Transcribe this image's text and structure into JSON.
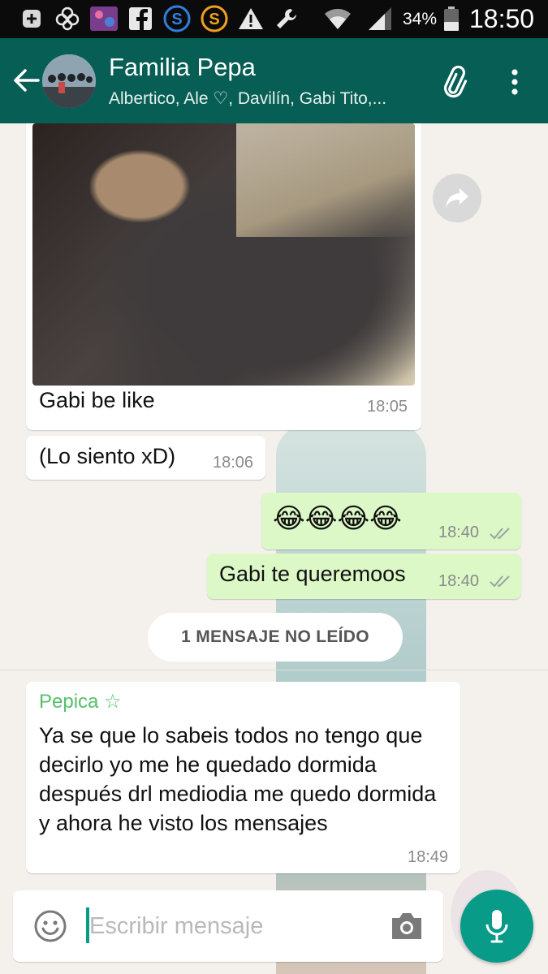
{
  "status_bar": {
    "battery_percent": "34%",
    "time": "18:50",
    "icons": [
      "plus-box-icon",
      "clover-icon",
      "gallery-icon",
      "facebook-icon",
      "s-blue-icon",
      "s-orange-icon",
      "warning-icon",
      "wrench-icon",
      "wifi-icon",
      "signal-icon",
      "battery-icon"
    ]
  },
  "header": {
    "title": "Familia Pepa",
    "subtitle": "Albertico, Ale ♡, Davilín, Gabi Tito,...",
    "back_icon": "arrow-left-icon",
    "attach_icon": "paperclip-icon",
    "menu_icon": "more-vertical-icon"
  },
  "messages": [
    {
      "type": "image",
      "direction": "in",
      "caption": "Gabi be like",
      "time": "18:05"
    },
    {
      "type": "text",
      "direction": "in",
      "text": "(Lo siento xD)",
      "time": "18:06"
    },
    {
      "type": "text",
      "direction": "out",
      "text": "😂😂😂😂",
      "time": "18:40",
      "status": "read"
    },
    {
      "type": "text",
      "direction": "out",
      "text": "Gabi te queremoos",
      "time": "18:40",
      "status": "read"
    },
    {
      "type": "text",
      "direction": "in",
      "sender": "Pepica ☆",
      "text": "Ya se que lo sabeis todos no tengo que decirlo yo me he quedado dormida después drl mediodia me quedo dormida y ahora he visto los mensajes",
      "time": "18:49"
    }
  ],
  "unread_divider": "1 MENSAJE NO LEÍDO",
  "composer": {
    "placeholder": "Escribir mensaje",
    "value": ""
  },
  "colors": {
    "header": "#075e54",
    "outgoing_bubble": "#dcf8c6",
    "accent": "#079b88",
    "sender_name": "#54c16a"
  }
}
